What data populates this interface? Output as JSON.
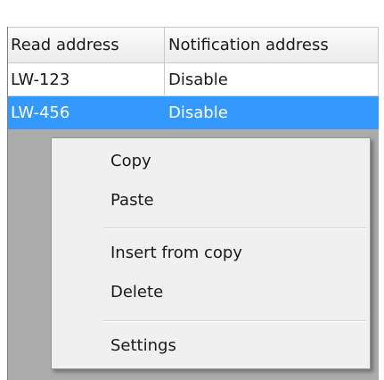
{
  "grid": {
    "columns": [
      "Read address",
      "Notification address"
    ],
    "rows": [
      {
        "read_address": "LW-123",
        "notification_address": "Disable",
        "selected": false
      },
      {
        "read_address": "LW-456",
        "notification_address": "Disable",
        "selected": true
      }
    ]
  },
  "context_menu": {
    "items": [
      {
        "label": "Copy"
      },
      {
        "label": "Paste"
      },
      {
        "label": "Insert from copy"
      },
      {
        "label": "Delete"
      },
      {
        "label": "Settings"
      }
    ]
  },
  "colors": {
    "selection": "#3399ff",
    "empty_grid_area": "#ababab",
    "menu_background": "#f0f0f0"
  }
}
